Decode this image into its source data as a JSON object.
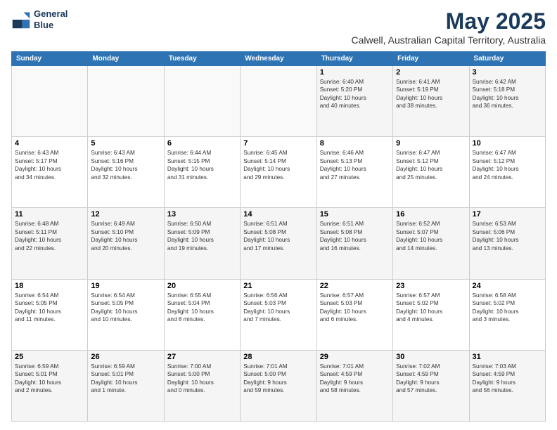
{
  "header": {
    "logo_line1": "General",
    "logo_line2": "Blue",
    "title": "May 2025",
    "subtitle": "Calwell, Australian Capital Territory, Australia"
  },
  "days_of_week": [
    "Sunday",
    "Monday",
    "Tuesday",
    "Wednesday",
    "Thursday",
    "Friday",
    "Saturday"
  ],
  "weeks": [
    [
      {
        "day": "",
        "info": ""
      },
      {
        "day": "",
        "info": ""
      },
      {
        "day": "",
        "info": ""
      },
      {
        "day": "",
        "info": ""
      },
      {
        "day": "1",
        "info": "Sunrise: 6:40 AM\nSunset: 5:20 PM\nDaylight: 10 hours\nand 40 minutes."
      },
      {
        "day": "2",
        "info": "Sunrise: 6:41 AM\nSunset: 5:19 PM\nDaylight: 10 hours\nand 38 minutes."
      },
      {
        "day": "3",
        "info": "Sunrise: 6:42 AM\nSunset: 5:18 PM\nDaylight: 10 hours\nand 36 minutes."
      }
    ],
    [
      {
        "day": "4",
        "info": "Sunrise: 6:43 AM\nSunset: 5:17 PM\nDaylight: 10 hours\nand 34 minutes."
      },
      {
        "day": "5",
        "info": "Sunrise: 6:43 AM\nSunset: 5:16 PM\nDaylight: 10 hours\nand 32 minutes."
      },
      {
        "day": "6",
        "info": "Sunrise: 6:44 AM\nSunset: 5:15 PM\nDaylight: 10 hours\nand 31 minutes."
      },
      {
        "day": "7",
        "info": "Sunrise: 6:45 AM\nSunset: 5:14 PM\nDaylight: 10 hours\nand 29 minutes."
      },
      {
        "day": "8",
        "info": "Sunrise: 6:46 AM\nSunset: 5:13 PM\nDaylight: 10 hours\nand 27 minutes."
      },
      {
        "day": "9",
        "info": "Sunrise: 6:47 AM\nSunset: 5:12 PM\nDaylight: 10 hours\nand 25 minutes."
      },
      {
        "day": "10",
        "info": "Sunrise: 6:47 AM\nSunset: 5:12 PM\nDaylight: 10 hours\nand 24 minutes."
      }
    ],
    [
      {
        "day": "11",
        "info": "Sunrise: 6:48 AM\nSunset: 5:11 PM\nDaylight: 10 hours\nand 22 minutes."
      },
      {
        "day": "12",
        "info": "Sunrise: 6:49 AM\nSunset: 5:10 PM\nDaylight: 10 hours\nand 20 minutes."
      },
      {
        "day": "13",
        "info": "Sunrise: 6:50 AM\nSunset: 5:09 PM\nDaylight: 10 hours\nand 19 minutes."
      },
      {
        "day": "14",
        "info": "Sunrise: 6:51 AM\nSunset: 5:08 PM\nDaylight: 10 hours\nand 17 minutes."
      },
      {
        "day": "15",
        "info": "Sunrise: 6:51 AM\nSunset: 5:08 PM\nDaylight: 10 hours\nand 16 minutes."
      },
      {
        "day": "16",
        "info": "Sunrise: 6:52 AM\nSunset: 5:07 PM\nDaylight: 10 hours\nand 14 minutes."
      },
      {
        "day": "17",
        "info": "Sunrise: 6:53 AM\nSunset: 5:06 PM\nDaylight: 10 hours\nand 13 minutes."
      }
    ],
    [
      {
        "day": "18",
        "info": "Sunrise: 6:54 AM\nSunset: 5:05 PM\nDaylight: 10 hours\nand 11 minutes."
      },
      {
        "day": "19",
        "info": "Sunrise: 6:54 AM\nSunset: 5:05 PM\nDaylight: 10 hours\nand 10 minutes."
      },
      {
        "day": "20",
        "info": "Sunrise: 6:55 AM\nSunset: 5:04 PM\nDaylight: 10 hours\nand 8 minutes."
      },
      {
        "day": "21",
        "info": "Sunrise: 6:56 AM\nSunset: 5:03 PM\nDaylight: 10 hours\nand 7 minutes."
      },
      {
        "day": "22",
        "info": "Sunrise: 6:57 AM\nSunset: 5:03 PM\nDaylight: 10 hours\nand 6 minutes."
      },
      {
        "day": "23",
        "info": "Sunrise: 6:57 AM\nSunset: 5:02 PM\nDaylight: 10 hours\nand 4 minutes."
      },
      {
        "day": "24",
        "info": "Sunrise: 6:58 AM\nSunset: 5:02 PM\nDaylight: 10 hours\nand 3 minutes."
      }
    ],
    [
      {
        "day": "25",
        "info": "Sunrise: 6:59 AM\nSunset: 5:01 PM\nDaylight: 10 hours\nand 2 minutes."
      },
      {
        "day": "26",
        "info": "Sunrise: 6:59 AM\nSunset: 5:01 PM\nDaylight: 10 hours\nand 1 minute."
      },
      {
        "day": "27",
        "info": "Sunrise: 7:00 AM\nSunset: 5:00 PM\nDaylight: 10 hours\nand 0 minutes."
      },
      {
        "day": "28",
        "info": "Sunrise: 7:01 AM\nSunset: 5:00 PM\nDaylight: 9 hours\nand 59 minutes."
      },
      {
        "day": "29",
        "info": "Sunrise: 7:01 AM\nSunset: 4:59 PM\nDaylight: 9 hours\nand 58 minutes."
      },
      {
        "day": "30",
        "info": "Sunrise: 7:02 AM\nSunset: 4:59 PM\nDaylight: 9 hours\nand 57 minutes."
      },
      {
        "day": "31",
        "info": "Sunrise: 7:03 AM\nSunset: 4:59 PM\nDaylight: 9 hours\nand 56 minutes."
      }
    ]
  ]
}
